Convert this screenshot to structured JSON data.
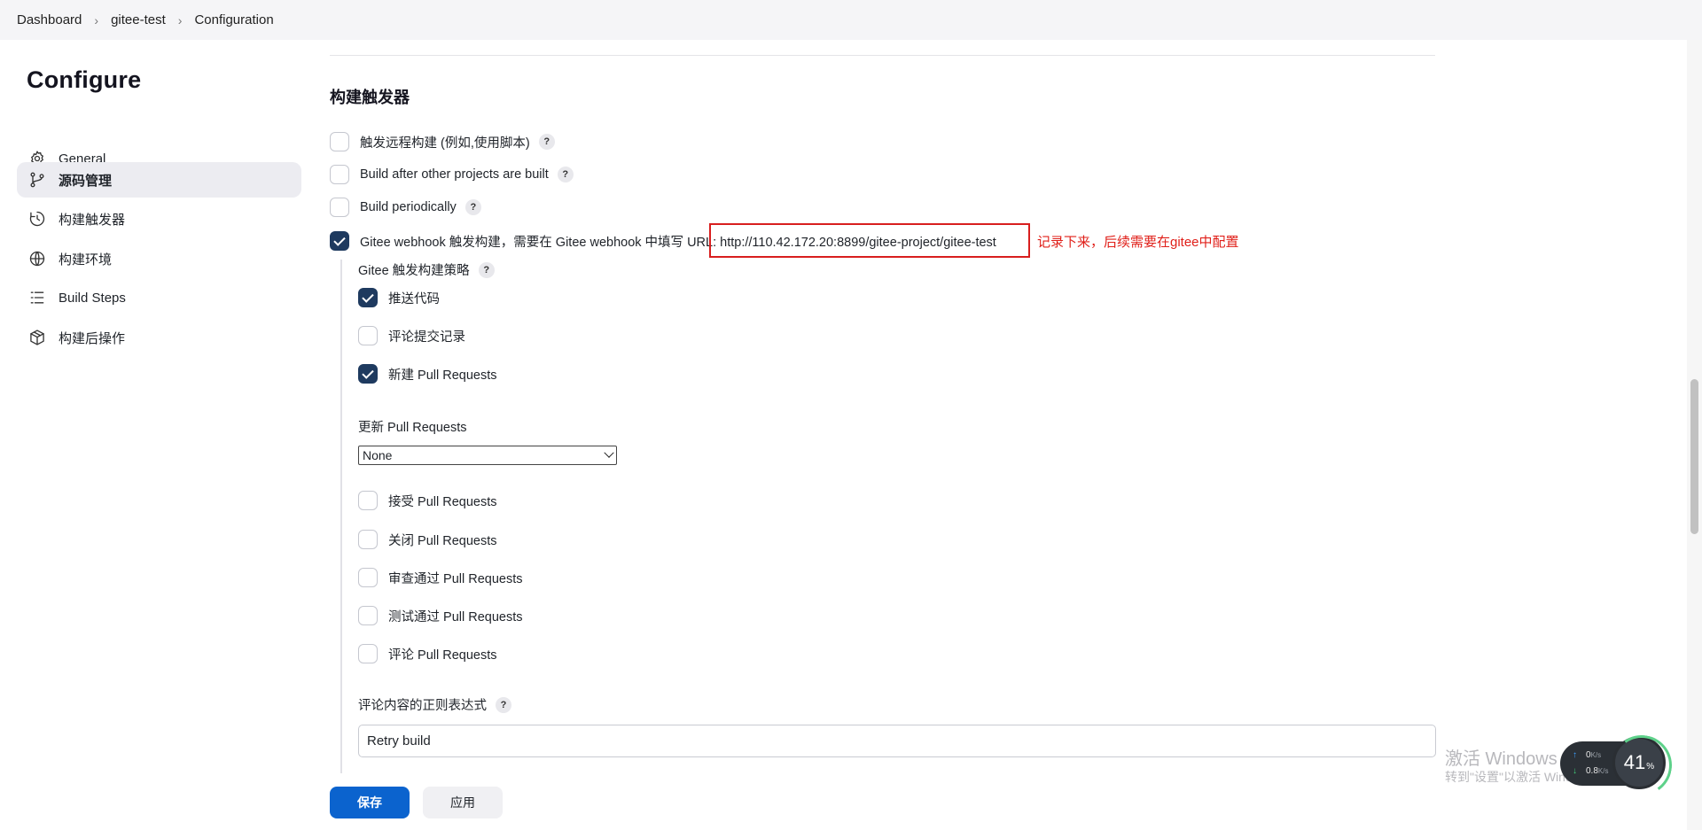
{
  "breadcrumb": [
    "Dashboard",
    "gitee-test",
    "Configuration"
  ],
  "sidebar": {
    "title": "Configure",
    "items": [
      {
        "label": "General",
        "icon": "gear-icon"
      },
      {
        "label": "源码管理",
        "icon": "branch-icon",
        "active": true
      },
      {
        "label": "构建触发器",
        "icon": "clock-icon"
      },
      {
        "label": "构建环境",
        "icon": "globe-icon"
      },
      {
        "label": "Build Steps",
        "icon": "list-icon"
      },
      {
        "label": "构建后操作",
        "icon": "package-icon"
      }
    ]
  },
  "section": {
    "title": "构建触发器"
  },
  "triggers": [
    {
      "label": "触发远程构建 (例如,使用脚本)",
      "checked": false,
      "help": true
    },
    {
      "label": "Build after other projects are built",
      "checked": false,
      "help": true
    },
    {
      "label": "Build periodically",
      "checked": false,
      "help": true
    },
    {
      "label": "Gitee webhook 触发构建，需要在 Gitee webhook 中填写 URL: http://110.42.172.20:8899/gitee-project/gitee-test",
      "checked": true,
      "help": false
    }
  ],
  "annotation": "记录下来，后续需要在gitee中配置",
  "gitee": {
    "strategy_label": "Gitee 触发构建策略",
    "options_top": [
      {
        "label": "推送代码",
        "checked": true
      },
      {
        "label": "评论提交记录",
        "checked": false
      },
      {
        "label": "新建 Pull Requests",
        "checked": true
      }
    ],
    "update_pr_label": "更新 Pull Requests",
    "update_pr_value": "None",
    "options_bottom": [
      {
        "label": "接受 Pull Requests",
        "checked": false
      },
      {
        "label": "关闭 Pull Requests",
        "checked": false
      },
      {
        "label": "审查通过 Pull Requests",
        "checked": false
      },
      {
        "label": "测试通过 Pull Requests",
        "checked": false
      },
      {
        "label": "评论 Pull Requests",
        "checked": false
      }
    ],
    "regex_label": "评论内容的正则表达式",
    "regex_value": "Retry build"
  },
  "buttons": {
    "save": "保存",
    "apply": "应用"
  },
  "watermark": {
    "line1": "激活 Windows",
    "line2": "转到\"设置\"以激活 Windows。"
  },
  "netspeed": {
    "up": "0",
    "up_unit": "K/s",
    "down": "0.8",
    "down_unit": "K/s",
    "cpu": "41",
    "cpu_unit": "%"
  }
}
